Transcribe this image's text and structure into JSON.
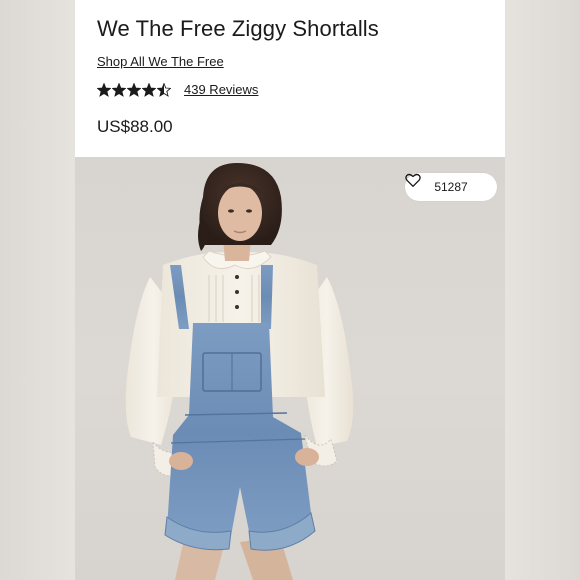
{
  "product": {
    "title": "We The Free Ziggy Shortalls",
    "shop_link": "Shop All We The Free",
    "rating": 4.5,
    "rating_max": 5,
    "reviews": "439 Reviews",
    "price": "US$88.00"
  },
  "photo": {
    "favorites_count": "51287",
    "favorite_icon": "heart-outline-icon",
    "description_icon": "model-photo"
  },
  "colors": {
    "text": "#1b1b1b",
    "denim": "#6f8fb6",
    "background": "#ffffff"
  }
}
